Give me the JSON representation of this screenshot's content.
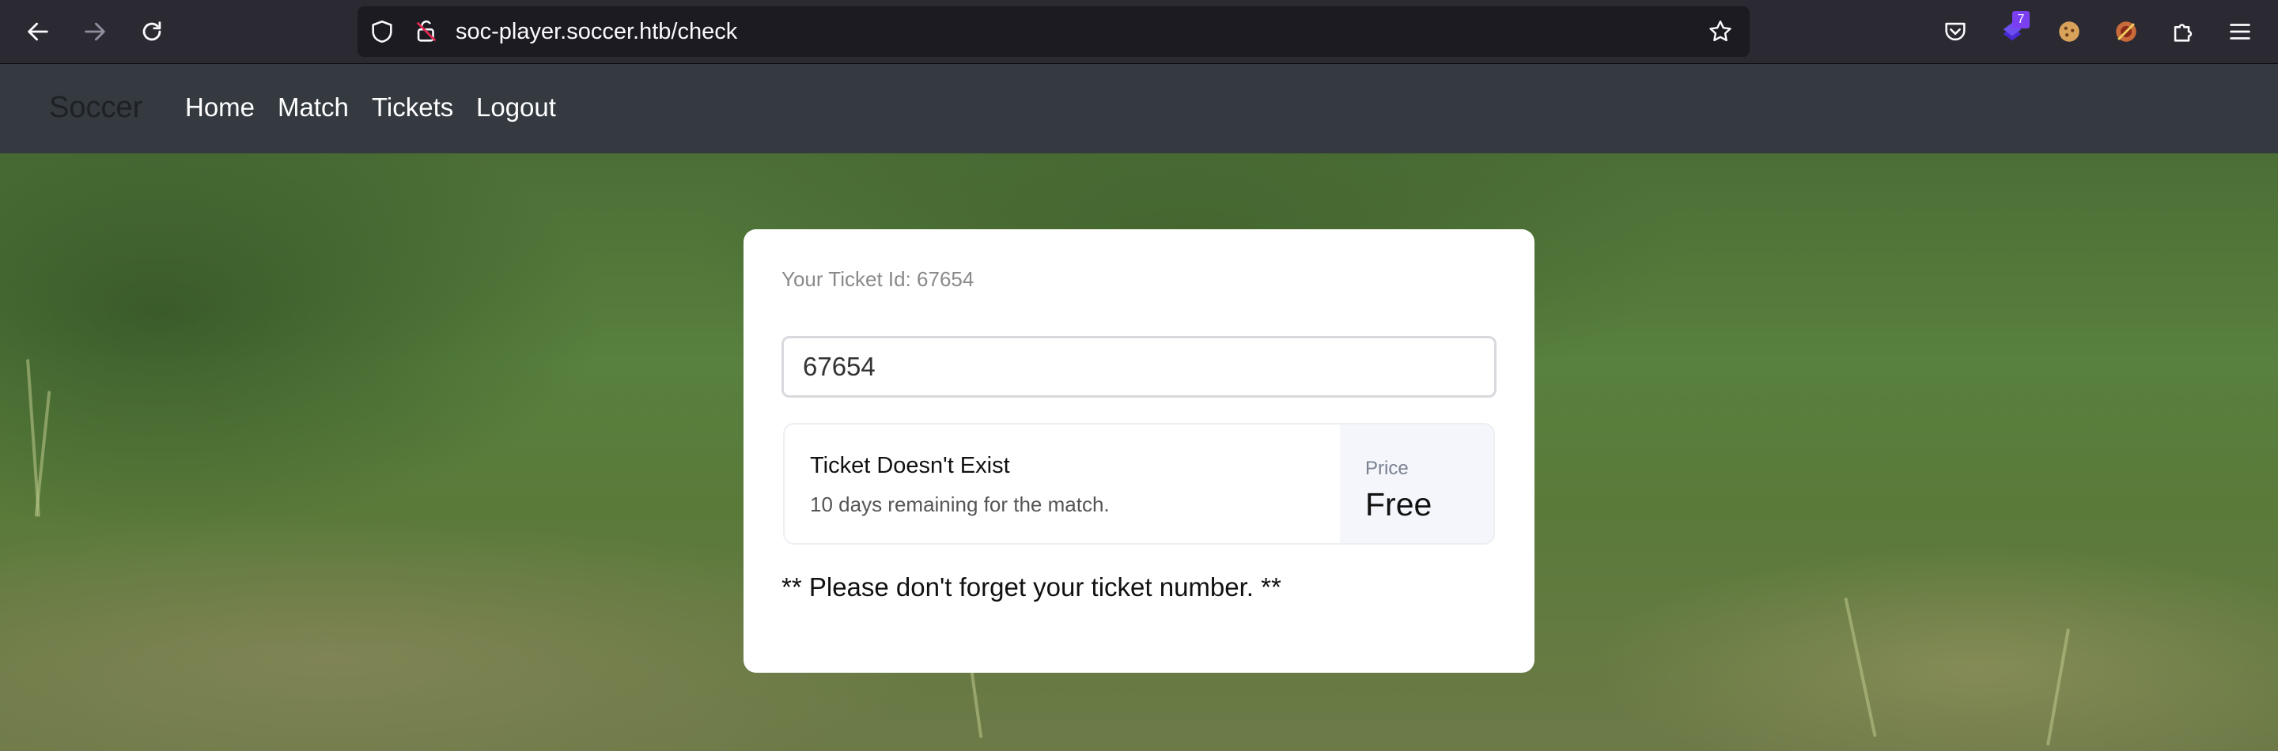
{
  "browser": {
    "url": "soc-player.soccer.htb/check",
    "extension_badge": "7"
  },
  "navbar": {
    "brand": "Soccer",
    "links": [
      "Home",
      "Match",
      "Tickets",
      "Logout"
    ]
  },
  "ticket_card": {
    "ticket_id_label": "Your Ticket Id: 67654",
    "input_value": "67654",
    "result_title": "Ticket Doesn't Exist",
    "result_subtitle": "10 days remaining for the match.",
    "price_label": "Price",
    "price_value": "Free",
    "reminder": "** Please don't forget your ticket number. **"
  },
  "colors": {
    "browser_bg": "#2b2a33",
    "url_bg": "#1c1b22",
    "navbar_bg": "#343a40",
    "card_bg": "#ffffff",
    "price_panel_bg": "#f4f6fb"
  }
}
